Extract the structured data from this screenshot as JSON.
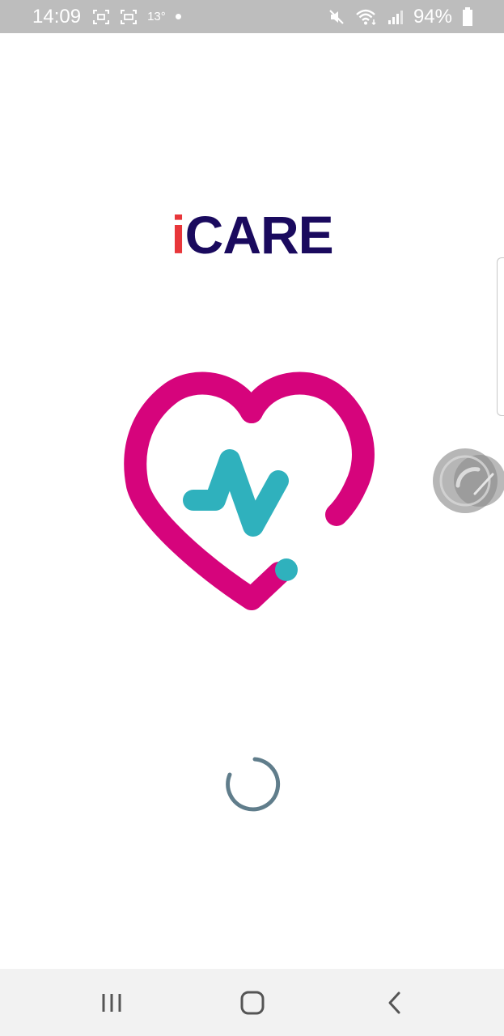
{
  "status_bar": {
    "time": "14:09",
    "temperature": "13°",
    "battery_percent": "94%",
    "icons": [
      "screenshot-icon",
      "screen-record-icon",
      "mute-icon",
      "wifi-icon",
      "signal-icon",
      "battery-icon"
    ]
  },
  "app": {
    "logo_i": "i",
    "logo_rest": "CARE"
  },
  "colors": {
    "heart": "#d6047c",
    "pulse": "#2fb1bd",
    "logo_i": "#e8363a",
    "logo_text": "#1a0a5e",
    "spinner": "#607d8b",
    "status_bar_bg": "#bdbdbd",
    "nav_bar_bg": "#f2f2f2"
  },
  "loading": {
    "state": "loading"
  },
  "nav_bar": {
    "buttons": [
      "recent-apps",
      "home",
      "back"
    ]
  }
}
